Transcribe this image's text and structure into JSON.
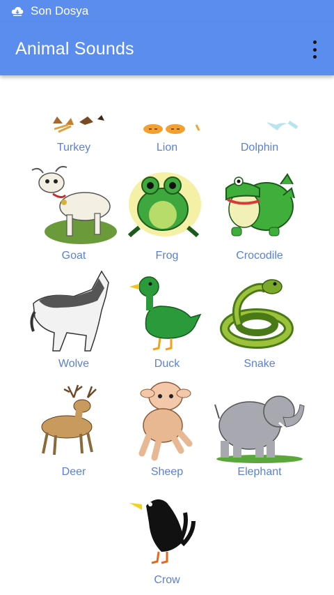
{
  "status_bar": {
    "notification_text": "Son Dosya",
    "icon": "cloud-download-icon"
  },
  "app_bar": {
    "title": "Animal Sounds",
    "menu_icon": "overflow-menu-icon"
  },
  "animals": [
    {
      "label": "Turkey"
    },
    {
      "label": "Lion"
    },
    {
      "label": "Dolphin"
    },
    {
      "label": "Goat"
    },
    {
      "label": "Frog"
    },
    {
      "label": "Crocodile"
    },
    {
      "label": "Wolve"
    },
    {
      "label": "Duck"
    },
    {
      "label": "Snake"
    },
    {
      "label": "Deer"
    },
    {
      "label": "Sheep"
    },
    {
      "label": "Elephant"
    },
    {
      "label": "Crow"
    }
  ],
  "colors": {
    "primary": "#5b8def",
    "label_text": "#5b7fd6"
  }
}
